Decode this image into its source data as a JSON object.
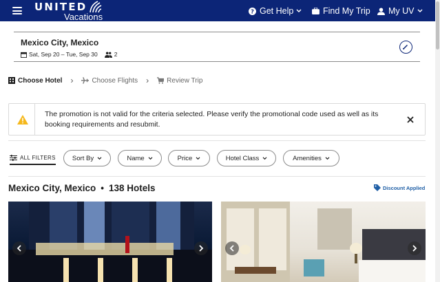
{
  "header": {
    "logo_name": "UNITED",
    "logo_sub": "Vacations",
    "bg_color": "#0c2577",
    "nav": [
      {
        "label": "Get Help",
        "icon": "help-circle-icon"
      },
      {
        "label": "Find My Trip",
        "icon": "suitcase-icon"
      },
      {
        "label": "My UV",
        "icon": "user-icon"
      }
    ]
  },
  "trip": {
    "destination": "Mexico City, Mexico",
    "dates": "Sat, Sep 20 – Tue, Sep 30",
    "travelers": "2"
  },
  "steps": [
    {
      "label": "Choose Hotel",
      "icon": "hotel-icon",
      "active": true
    },
    {
      "label": "Choose Flights",
      "icon": "plane-icon",
      "active": false
    },
    {
      "label": "Review Trip",
      "icon": "cart-icon",
      "active": false
    }
  ],
  "alert": {
    "message": "The promotion is not valid for the criteria selected. Please verify the promotional code used as well as its booking requirements and resubmit.",
    "icon": "warning-icon",
    "accent_color": "#f5b81c"
  },
  "filters": {
    "all_label": "ALL FILTERS",
    "pills": [
      "Sort By",
      "Name",
      "Price",
      "Hotel Class",
      "Amenities"
    ]
  },
  "results": {
    "city": "Mexico City, Mexico",
    "separator": "•",
    "count": "138 Hotels",
    "discount_label": "Discount Applied",
    "discount_color": "#1f5fa6"
  }
}
